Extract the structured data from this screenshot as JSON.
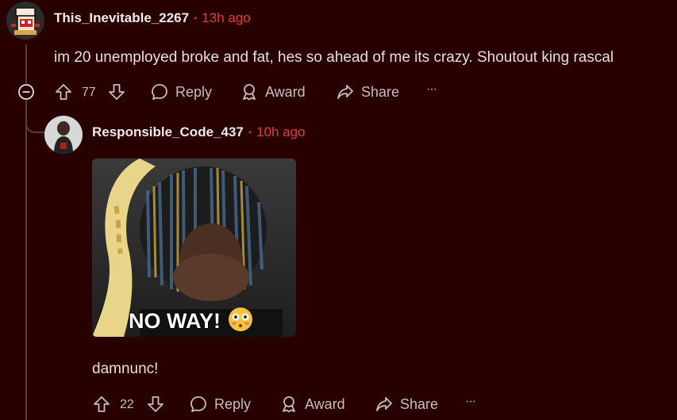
{
  "colors": {
    "background": "#280000",
    "username": "#f2eaea",
    "timestamp": "#e23b3f",
    "action": "#c9bcbc"
  },
  "comment1": {
    "username": "This_Inevitable_2267",
    "separator": "•",
    "timestamp": "13h ago",
    "body": "im 20 unemployed broke and fat, hes so ahead of me its crazy. Shoutout king rascal",
    "votes": "77",
    "reply_label": "Reply",
    "award_label": "Award",
    "share_label": "Share",
    "more_label": "···"
  },
  "comment2": {
    "username": "Responsible_Code_437",
    "separator": "•",
    "timestamp": "10h ago",
    "media_caption": "NO WAY!",
    "body": "damnunc!",
    "votes": "22",
    "reply_label": "Reply",
    "award_label": "Award",
    "share_label": "Share",
    "more_label": "···"
  }
}
